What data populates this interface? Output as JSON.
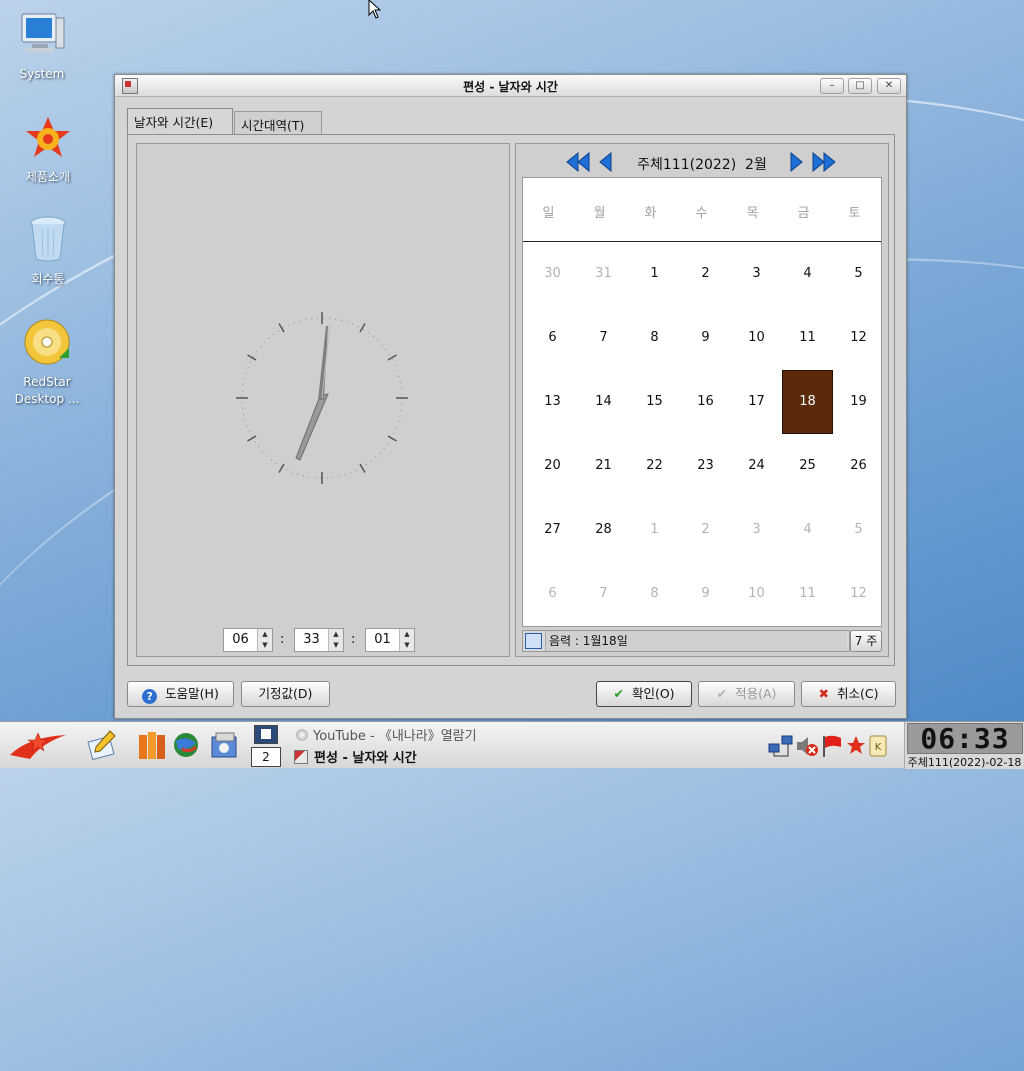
{
  "desktop": {
    "icons": [
      {
        "label": "System"
      },
      {
        "label": "제품소개"
      },
      {
        "label": "회수통"
      },
      {
        "label": "RedStar\nDesktop ..."
      }
    ]
  },
  "window": {
    "title": "편성 - 날자와 시간",
    "tabs": [
      {
        "label": "날자와 시간(E)"
      },
      {
        "label": "시간대역(T)"
      }
    ],
    "time": {
      "hour": "06",
      "minute": "33",
      "second": "01",
      "separator": ":"
    },
    "calendar": {
      "month_label": "주체111(2022)  2월",
      "weekdays": [
        "일",
        "월",
        "화",
        "수",
        "목",
        "금",
        "토"
      ],
      "weeks": [
        [
          {
            "d": "30",
            "dim": true
          },
          {
            "d": "31",
            "dim": true
          },
          {
            "d": "1"
          },
          {
            "d": "2"
          },
          {
            "d": "3"
          },
          {
            "d": "4"
          },
          {
            "d": "5"
          }
        ],
        [
          {
            "d": "6"
          },
          {
            "d": "7"
          },
          {
            "d": "8"
          },
          {
            "d": "9"
          },
          {
            "d": "10"
          },
          {
            "d": "11"
          },
          {
            "d": "12"
          }
        ],
        [
          {
            "d": "13"
          },
          {
            "d": "14"
          },
          {
            "d": "15"
          },
          {
            "d": "16"
          },
          {
            "d": "17"
          },
          {
            "d": "18",
            "sel": true
          },
          {
            "d": "19"
          }
        ],
        [
          {
            "d": "20"
          },
          {
            "d": "21"
          },
          {
            "d": "22"
          },
          {
            "d": "23"
          },
          {
            "d": "24"
          },
          {
            "d": "25"
          },
          {
            "d": "26"
          }
        ],
        [
          {
            "d": "27"
          },
          {
            "d": "28"
          },
          {
            "d": "1",
            "dim": true
          },
          {
            "d": "2",
            "dim": true
          },
          {
            "d": "3",
            "dim": true
          },
          {
            "d": "4",
            "dim": true
          },
          {
            "d": "5",
            "dim": true
          }
        ],
        [
          {
            "d": "6",
            "dim": true
          },
          {
            "d": "7",
            "dim": true
          },
          {
            "d": "8",
            "dim": true
          },
          {
            "d": "9",
            "dim": true
          },
          {
            "d": "10",
            "dim": true
          },
          {
            "d": "11",
            "dim": true
          },
          {
            "d": "12",
            "dim": true
          }
        ]
      ],
      "lunar_text": "음력 : 1월18일",
      "week_label": "7 주",
      "selected_color": "#5a2a0a"
    },
    "buttons": {
      "help": "도움말(H)",
      "defaults": "기정값(D)",
      "ok": "확인(O)",
      "apply": "적용(A)",
      "cancel": "취소(C)"
    }
  },
  "taskbar": {
    "pager_number": "2",
    "tasks": [
      {
        "label": "YouTube - 《내나라》열람기"
      },
      {
        "label": "편성 - 날자와 시간"
      }
    ],
    "clock_time": "06:33",
    "clock_date": "주체111(2022)-02-18"
  }
}
